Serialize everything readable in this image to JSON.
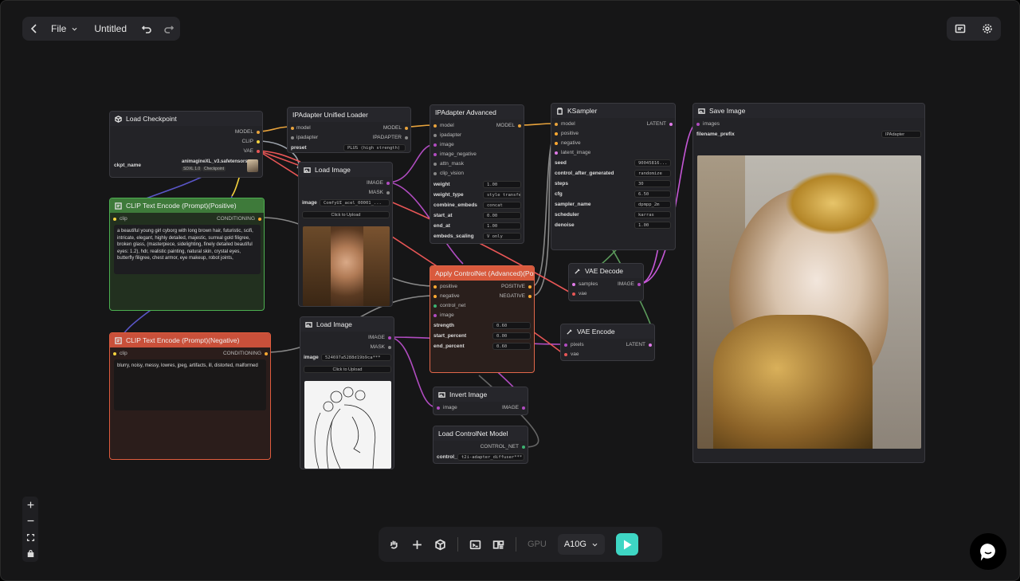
{
  "topbar": {
    "file": "File",
    "title": "Untitled"
  },
  "toolbar": {
    "gpu_label": "GPU",
    "gpu_value": "A10G"
  },
  "nodes": {
    "checkpoint": {
      "title": "Load Checkpoint",
      "out_model": "MODEL",
      "out_clip": "CLIP",
      "out_vae": "VAE",
      "param": "ckpt_name",
      "value": "animagineXL_v3.safetensors",
      "tag1": "SDXL 1.0",
      "tag2": "Checkpoint"
    },
    "clip_pos": {
      "title": "CLIP Text Encode (Prompt)(Positive)",
      "in": "clip",
      "out": "CONDITIONING",
      "text": "a beautiful young girl cyborg with long brown hair, futuristic, scifi, intricate, elegant, highly detailed, majestic, surreal gold filigree, broken glass, (masterpiece, sidelighting, finely detailed beautiful eyes: 1.2), hdr, realistic painting, natural skin, crystal eyes, butterfly filigree, chest armor, eye makeup, robot joints,"
    },
    "clip_neg": {
      "title": "CLIP Text Encode (Prompt)(Negative)",
      "in": "clip",
      "out": "CONDITIONING",
      "text": "blurry, noisy, messy, lowres, jpeg, artifacts, ill, distorted, malformed"
    },
    "ipa_loader": {
      "title": "IPAdapter Unified Loader",
      "in_model": "model",
      "in_ipadapter": "ipadapter",
      "out_model": "MODEL",
      "out_ipadapter": "IPADAPTER",
      "param": "preset",
      "value": "PLUS (high strength)"
    },
    "load_image1": {
      "title": "Load Image",
      "out_image": "IMAGE",
      "out_mask": "MASK",
      "param": "image",
      "value": "ComfyUI_acel_00001_...",
      "upload": "Click to Upload"
    },
    "load_image2": {
      "title": "Load Image",
      "out_image": "IMAGE",
      "out_mask": "MASK",
      "param": "image",
      "value": "524697a5288d19b9ca***",
      "upload": "Click to Upload"
    },
    "ipa_adv": {
      "title": "IPAdapter Advanced",
      "inputs": [
        "model",
        "ipadapter",
        "image",
        "image_negative",
        "attn_mask",
        "clip_vision"
      ],
      "out": "MODEL",
      "params": [
        {
          "k": "weight",
          "v": "1.00"
        },
        {
          "k": "weight_type",
          "v": "style transfer"
        },
        {
          "k": "combine_embeds",
          "v": "concat"
        },
        {
          "k": "start_at",
          "v": "0.00"
        },
        {
          "k": "end_at",
          "v": "1.00"
        },
        {
          "k": "embeds_scaling",
          "v": "V only"
        }
      ]
    },
    "controlnet": {
      "title": "Apply ControlNet (Advanced)(Positive)(Negative)",
      "inputs": [
        "positive",
        "negative",
        "control_net",
        "image"
      ],
      "out_pos": "POSITIVE",
      "out_neg": "NEGATIVE",
      "params": [
        {
          "k": "strength",
          "v": "0.60"
        },
        {
          "k": "start_percent",
          "v": "0.00"
        },
        {
          "k": "end_percent",
          "v": "0.60"
        }
      ]
    },
    "ksampler": {
      "title": "KSampler",
      "inputs": [
        "model",
        "positive",
        "negative",
        "latent_image"
      ],
      "out": "LATENT",
      "params": [
        {
          "k": "seed",
          "v": "90045816..."
        },
        {
          "k": "control_after_generated",
          "v": "randomize"
        },
        {
          "k": "steps",
          "v": "30"
        },
        {
          "k": "cfg",
          "v": "6.50"
        },
        {
          "k": "sampler_name",
          "v": "dpmpp_2m"
        },
        {
          "k": "scheduler",
          "v": "karras"
        },
        {
          "k": "denoise",
          "v": "1.00"
        }
      ]
    },
    "vae_decode": {
      "title": "VAE Decode",
      "in1": "samples",
      "in2": "vae",
      "out": "IMAGE"
    },
    "vae_encode": {
      "title": "VAE Encode",
      "in1": "pixels",
      "in2": "vae",
      "out": "LATENT"
    },
    "save": {
      "title": "Save Image",
      "in": "images",
      "param": "filename_prefix",
      "value": "IPAdapter"
    },
    "invert": {
      "title": "Invert Image",
      "in": "image",
      "out": "IMAGE"
    },
    "cn_loader": {
      "title": "Load ControlNet Model",
      "out": "CONTROL_NET",
      "param": "control_",
      "value": "t2i-adapter_diffuser***"
    }
  },
  "colors": {
    "model": "#e8a33c",
    "clip": "#f5d33e",
    "vae": "#e85656",
    "conditioning": "#ffa931",
    "image": "#b04cc0",
    "latent": "#e07be8",
    "green_node": "#3e7a3a",
    "red_node": "#c9503a",
    "run": "#3ed6c4"
  }
}
